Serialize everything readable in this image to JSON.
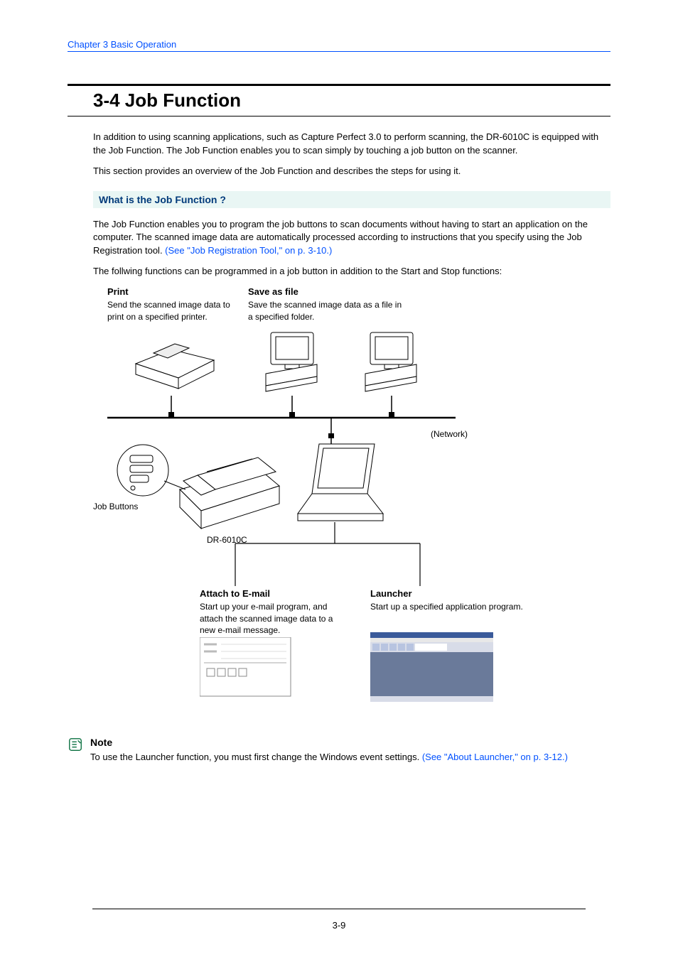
{
  "header": {
    "breadcrumb": "Chapter 3   Basic Operation"
  },
  "title": "3-4  Job Function",
  "intro": {
    "p1": "In addition to using scanning applications, such as Capture Perfect 3.0 to perform scanning, the DR-6010C is equipped with the Job Function. The Job Function enables you to scan simply by touching a job button on the scanner.",
    "p2": "This section provides an overview of the Job Function and describes the steps for using it."
  },
  "section": {
    "heading": "What is the Job Function ?"
  },
  "job_desc": {
    "p1a": "The Job Function enables you to program the job buttons to scan documents without having to start an application on the computer. The scanned image data are automatically processed according to instructions that you specify using the Job Registration tool. ",
    "p1_link": "(See \"Job Registration Tool,\" on p. 3-10.)",
    "p2": "The follwing functions can be programmed in a job button in addition to the Start and Stop functions:"
  },
  "diagram": {
    "print": {
      "title": "Print",
      "desc": "Send the scanned image data to print on a specified printer."
    },
    "save": {
      "title": "Save as file",
      "desc": "Save the scanned image data as a file in a specified folder."
    },
    "network_label": "(Network)",
    "job_buttons_label": "Job Buttons",
    "model_label": "DR-6010C",
    "email": {
      "title": "Attach to E-mail",
      "desc": "Start up your e-mail program, and attach the scanned image data to a new e-mail message."
    },
    "launcher": {
      "title": "Launcher",
      "desc": "Start up a specified application program."
    }
  },
  "note": {
    "head": "Note",
    "body_a": "To use the Launcher function, you must first change the Windows event settings. ",
    "body_link": "(See \"About Launcher,\" on p. 3-12.)"
  },
  "page_number": "3-9"
}
